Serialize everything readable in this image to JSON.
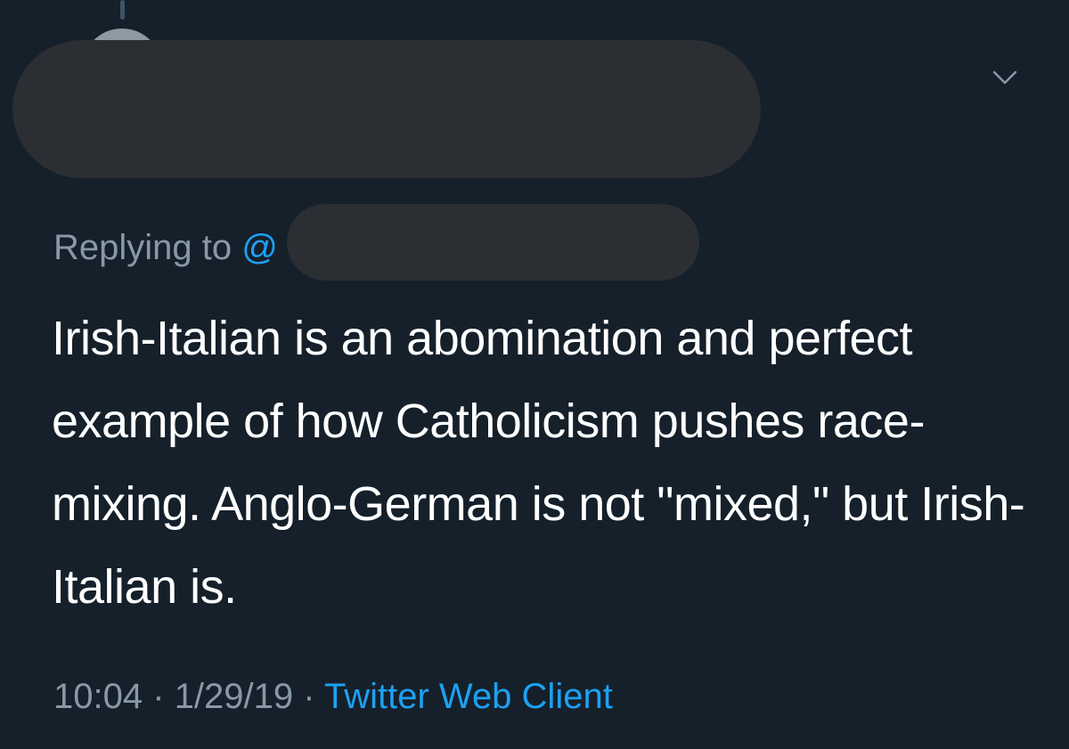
{
  "tweet": {
    "replying_to_prefix": "Replying to",
    "replying_at": "@",
    "text": "Irish-Italian is an abomination and perfect example of how Catholicism pushes race-mixing. Anglo-German is not \"mixed,\" but Irish-Italian is.",
    "time": "10:04",
    "date": "1/29/19",
    "separator": "·",
    "client": "Twitter Web Client"
  },
  "icons": {
    "menu_caret": "chevron-down-icon"
  },
  "colors": {
    "background": "#15202b",
    "text_primary": "#ffffff",
    "text_secondary": "#8899a6",
    "link": "#1da1f2",
    "redaction": "#2b2e33"
  }
}
